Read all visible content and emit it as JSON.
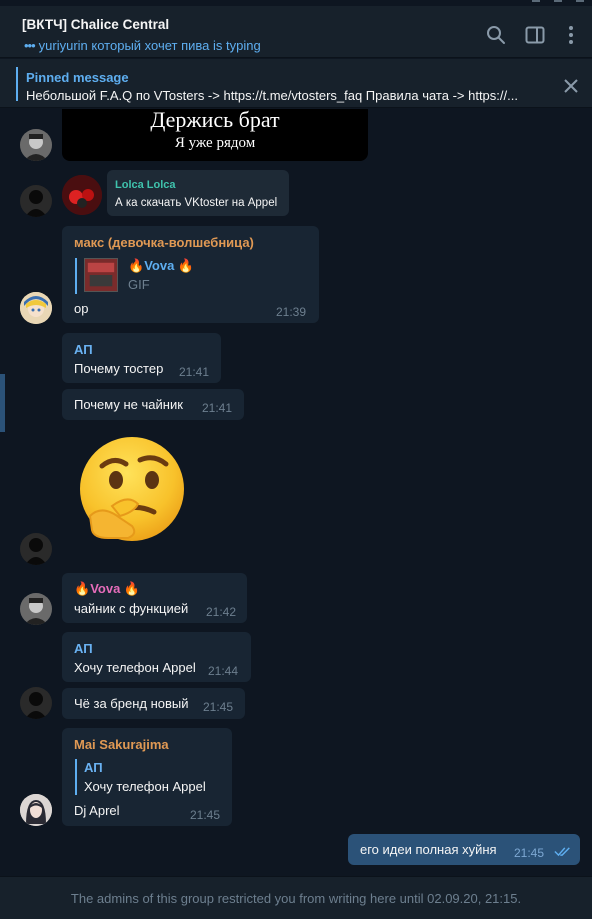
{
  "chat": {
    "title": "[ВКТЧ] Chalice Central",
    "typing_text": "yuriyurin который хочет пива is typing"
  },
  "pinned": {
    "label": "Pinned message",
    "text": "Небольшой F.A.Q по VTosters -> https://t.me/vtosters_faq Правила чата -> https://..."
  },
  "sticker_top": {
    "line1": "Держись брат",
    "line2": "Я уже рядом"
  },
  "messages": [
    {
      "sender": "Lolca Lolca",
      "text": "А ка скачать VKtoster на Appel"
    },
    {
      "sender": "макс (девочка-волшебница)",
      "reply_name": "Vova",
      "reply_type": "GIF",
      "text": "ор",
      "time": "21:39"
    },
    {
      "sender": "АП",
      "text": "Почему тостер",
      "time": "21:41"
    },
    {
      "text": "Почему не чайник",
      "time": "21:41"
    },
    {
      "sender": "Vova",
      "text": "чайник с функцией",
      "time": "21:42"
    },
    {
      "sender": "АП",
      "text": "Хочу телефон Appel",
      "time": "21:44"
    },
    {
      "text": "Чё за бренд новый",
      "time": "21:45"
    },
    {
      "sender": "Mai Sakurajima",
      "reply_name": "АП",
      "reply_text": "Хочу телефон Appel",
      "text": "Dj Aprel",
      "time": "21:45"
    },
    {
      "text": "его идеи полная хуйня",
      "time": "21:45"
    }
  ],
  "footer": {
    "text": "The admins of this group restricted you from writing here until 02.09.20, 21:15."
  },
  "colors": {
    "background": "#0e1621",
    "panel": "#17212b",
    "bubble_in": "#182533",
    "bubble_out": "#2b5278",
    "accent": "#5eaef0",
    "name_orange": "#e09954",
    "name_pink": "#e56cba",
    "name_teal": "#3fc3ad",
    "name_blue": "#6ab2f2"
  },
  "icons": [
    "search-icon",
    "sidebar-toggle-icon",
    "more-icon",
    "close-icon",
    "fire-icon",
    "double-check-icon",
    "thinking-emoji"
  ]
}
